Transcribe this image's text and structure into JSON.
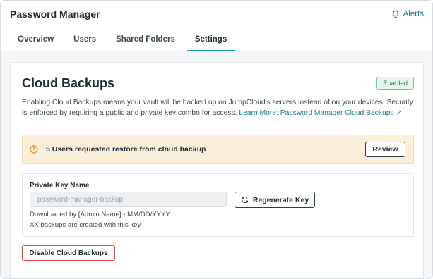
{
  "app": {
    "title": "Password Manager",
    "alerts_label": "Alerts",
    "alerts_icon": "bell-icon"
  },
  "tabs": [
    {
      "label": "Overview",
      "active": false
    },
    {
      "label": "Users",
      "active": false
    },
    {
      "label": "Shared Folders",
      "active": false
    },
    {
      "label": "Settings",
      "active": true
    }
  ],
  "section": {
    "title": "Cloud Backups",
    "status_badge": "Enabled",
    "description": "Enabling Cloud Backups means your vault will be backed up on JumpCloud's servers instead of on your devices. Security is enforced by requiring a public and private key combo for access.",
    "learn_more_link": "Learn More: Password Manager Cloud Backups ↗"
  },
  "restore_alert": {
    "icon": "warning-icon",
    "message": "5 Users requested restore from cloud backup",
    "button_label": "Review"
  },
  "private_key": {
    "label": "Private Key Name",
    "value": "",
    "placeholder": "password-manager-backup",
    "regenerate_label": "Regenerate Key",
    "regenerate_icon": "refresh-icon",
    "downloaded_by": "Downloaded by [Admin Name] - MM/DD/YYYY",
    "backup_note": "XX backups are created with this key"
  },
  "disable_button_label": "Disable Cloud Backups",
  "colors": {
    "accent": "#1fa5a5",
    "link": "#1a7f86",
    "warning_bg": "#fcefd9",
    "success_badge": "#e6f6ec",
    "danger": "#d64545"
  }
}
